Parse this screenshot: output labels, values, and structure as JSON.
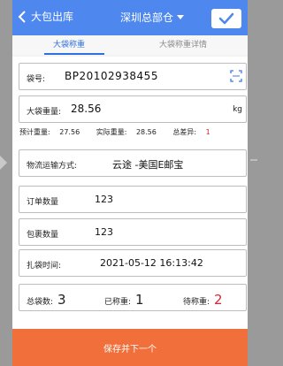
{
  "header": {
    "back_label": "大包出库",
    "location_title": "深圳总部仓"
  },
  "tabs": [
    {
      "label": "大袋称重",
      "active": true
    },
    {
      "label": "大袋称重详情",
      "active": false
    }
  ],
  "fields": {
    "bag_number": {
      "label": "袋号:",
      "value": "BP20102938455"
    },
    "bag_weight": {
      "label": "大袋重量:",
      "value": "28.56",
      "unit": "kg"
    },
    "estimated_weight": {
      "label": "预计重量:",
      "value": "27.56"
    },
    "actual_weight": {
      "label": "实际重量:",
      "value": "28.56"
    },
    "total_difference": {
      "label": "总差异:",
      "value": "1"
    },
    "logistics_method": {
      "label": "物流运输方式:",
      "value": "云途 -美国E邮宝"
    },
    "order_count": {
      "label": "订单数量",
      "value": "123"
    },
    "package_count": {
      "label": "包裹数量",
      "value": "123"
    },
    "bagging_time": {
      "label": "扎袋时间:",
      "value": "2021-05-12 16:13:42"
    },
    "totals": {
      "total_bags_label": "总袋数:",
      "total_bags": "3",
      "weighed_label": "已称重:",
      "weighed": "1",
      "pending_label": "待称重:",
      "pending": "2"
    }
  },
  "footer": {
    "save_label": "保存并下一个"
  },
  "colors": {
    "header_bg": "#4e88ee",
    "save_bg": "#f06f3a",
    "accent_red": "#e0242c",
    "tab_active": "#2f6fde"
  }
}
